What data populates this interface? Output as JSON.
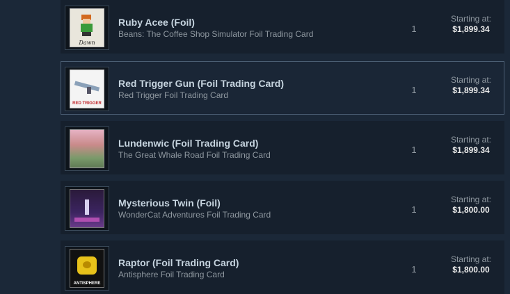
{
  "listings": [
    {
      "name": "Ruby Acee (Foil)",
      "game": "Beans: The Coffee Shop Simulator Foil Trading Card",
      "quantity": "1",
      "starting_label": "Starting at:",
      "price": "$1,899.34",
      "card_icon": "pixel-character-card-icon",
      "card_caption": "Dawn"
    },
    {
      "name": "Red Trigger Gun (Foil Trading Card)",
      "game": "Red Trigger Foil Trading Card",
      "quantity": "1",
      "starting_label": "Starting at:",
      "price": "$1,899.34",
      "card_icon": "gun-card-icon",
      "card_caption": "RED TRIGGER"
    },
    {
      "name": "Lundenwic (Foil Trading Card)",
      "game": "The Great Whale Road Foil Trading Card",
      "quantity": "1",
      "starting_label": "Starting at:",
      "price": "$1,899.34",
      "card_icon": "village-painting-card-icon",
      "card_caption": ""
    },
    {
      "name": "Mysterious Twin (Foil)",
      "game": "WonderCat Adventures Foil Trading Card",
      "quantity": "1",
      "starting_label": "Starting at:",
      "price": "$1,800.00",
      "card_icon": "purple-scene-card-icon",
      "card_caption": ""
    },
    {
      "name": "Raptor (Foil Trading Card)",
      "game": "Antisphere Foil Trading Card",
      "quantity": "1",
      "starting_label": "Starting at:",
      "price": "$1,800.00",
      "card_icon": "yellow-robot-card-icon",
      "card_caption": "ANTISPHERE"
    }
  ]
}
